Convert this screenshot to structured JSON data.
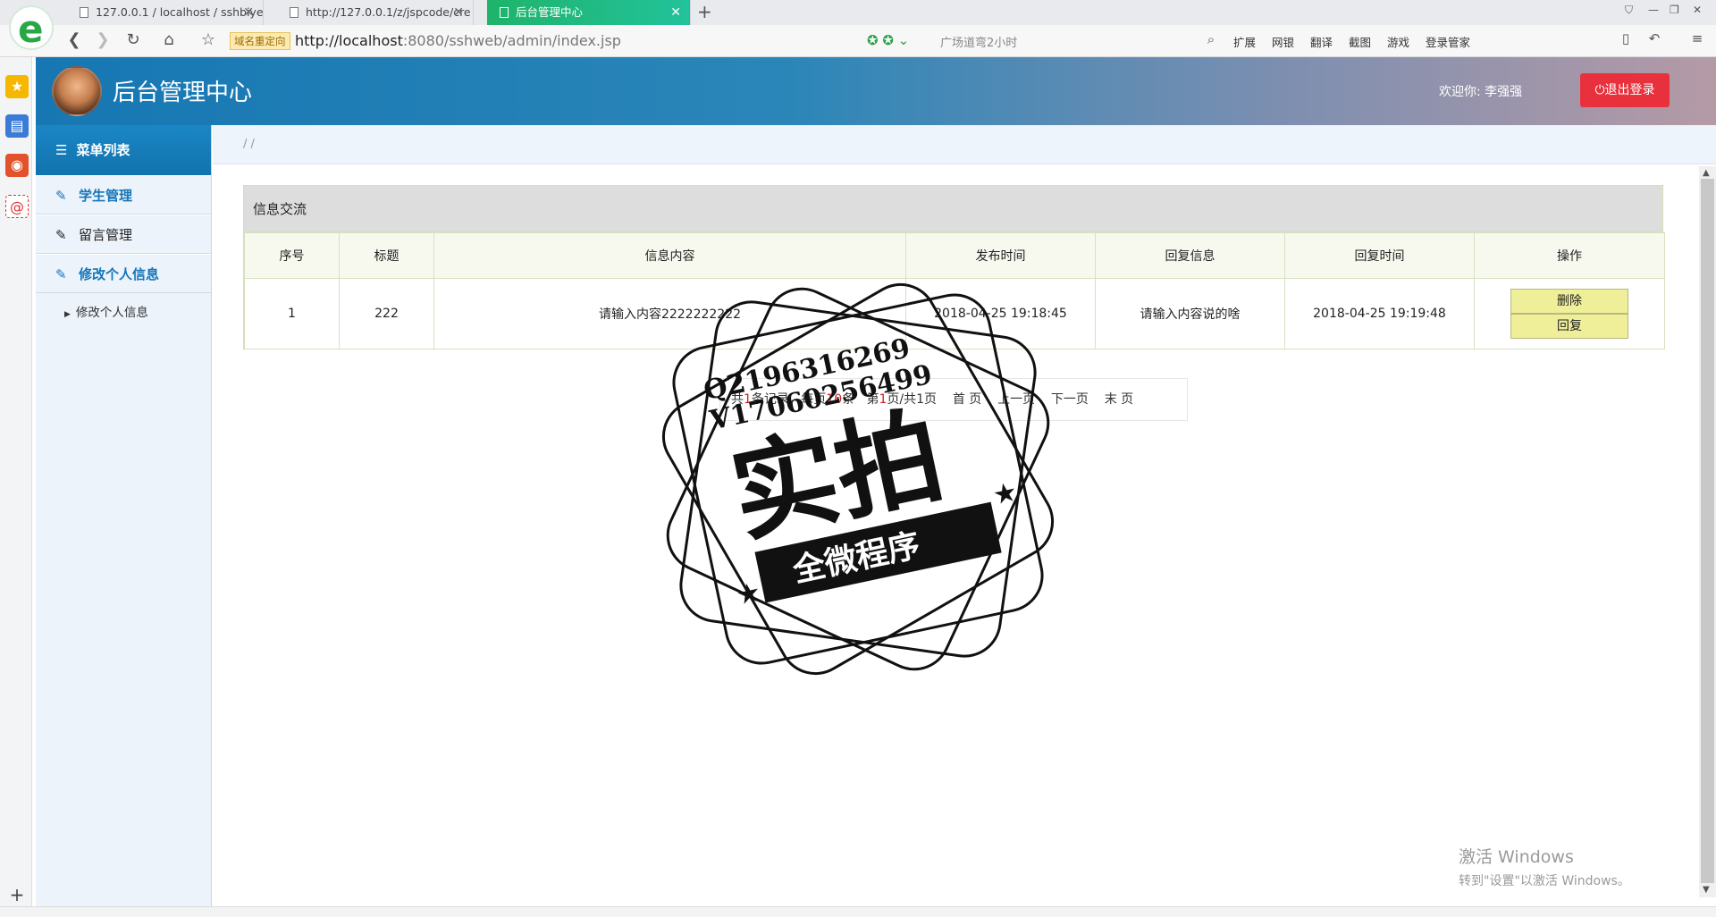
{
  "browser": {
    "tabs": [
      {
        "label": "127.0.0.1 / localhost / sshbiye"
      },
      {
        "label": "http://127.0.0.1/z/jspcode/cre"
      },
      {
        "label": "后台管理中心"
      }
    ],
    "redirect_badge": "域名重定向",
    "url_host": "http://localhost",
    "url_rest": ":8080/sshweb/admin/index.jsp",
    "address_hint": "广场道弯2小时",
    "toolbar": [
      "扩展",
      "网银",
      "翻译",
      "截图",
      "游戏",
      "登录管家"
    ]
  },
  "header": {
    "title": "后台管理中心",
    "welcome": "欢迎你: 李强强",
    "logout_label": "⏻退出登录"
  },
  "sidebar": {
    "menu_title": "菜单列表",
    "items": [
      {
        "label": "学生管理"
      },
      {
        "label": "留言管理"
      },
      {
        "label": "修改个人信息"
      }
    ],
    "sub_item": "修改个人信息"
  },
  "breadcrumb": "/   /",
  "panel": {
    "title": "信息交流",
    "columns": [
      "序号",
      "标题",
      "信息内容",
      "发布时间",
      "回复信息",
      "回复时间",
      "操作"
    ],
    "rows": [
      {
        "id": "1",
        "title": "222",
        "content": "请输入内容2222222222",
        "publish_time": "2018-04-25 19:18:45",
        "reply": "请输入内容说的啥",
        "reply_time": "2018-04-25 19:19:48",
        "actions": [
          "删除",
          "回复"
        ]
      }
    ]
  },
  "pager": {
    "total_prefix": "共",
    "total": "1",
    "total_suffix": "条记录",
    "per_prefix": "每页",
    "per_page": "10",
    "per_suffix": "条",
    "page_prefix": "第",
    "page": "1",
    "page_mid": "页/共",
    "pages": "1",
    "page_suffix": "页",
    "first": "首  页",
    "prev": "上一页",
    "next": "下一页",
    "last": "末  页"
  },
  "watermark": {
    "line1": "Q2196316269",
    "line2": "V17060256499",
    "main": "实拍",
    "ribbon": "全微程序"
  },
  "windows_activation": {
    "title": "激活 Windows",
    "subtitle": "转到\"设置\"以激活 Windows。"
  }
}
